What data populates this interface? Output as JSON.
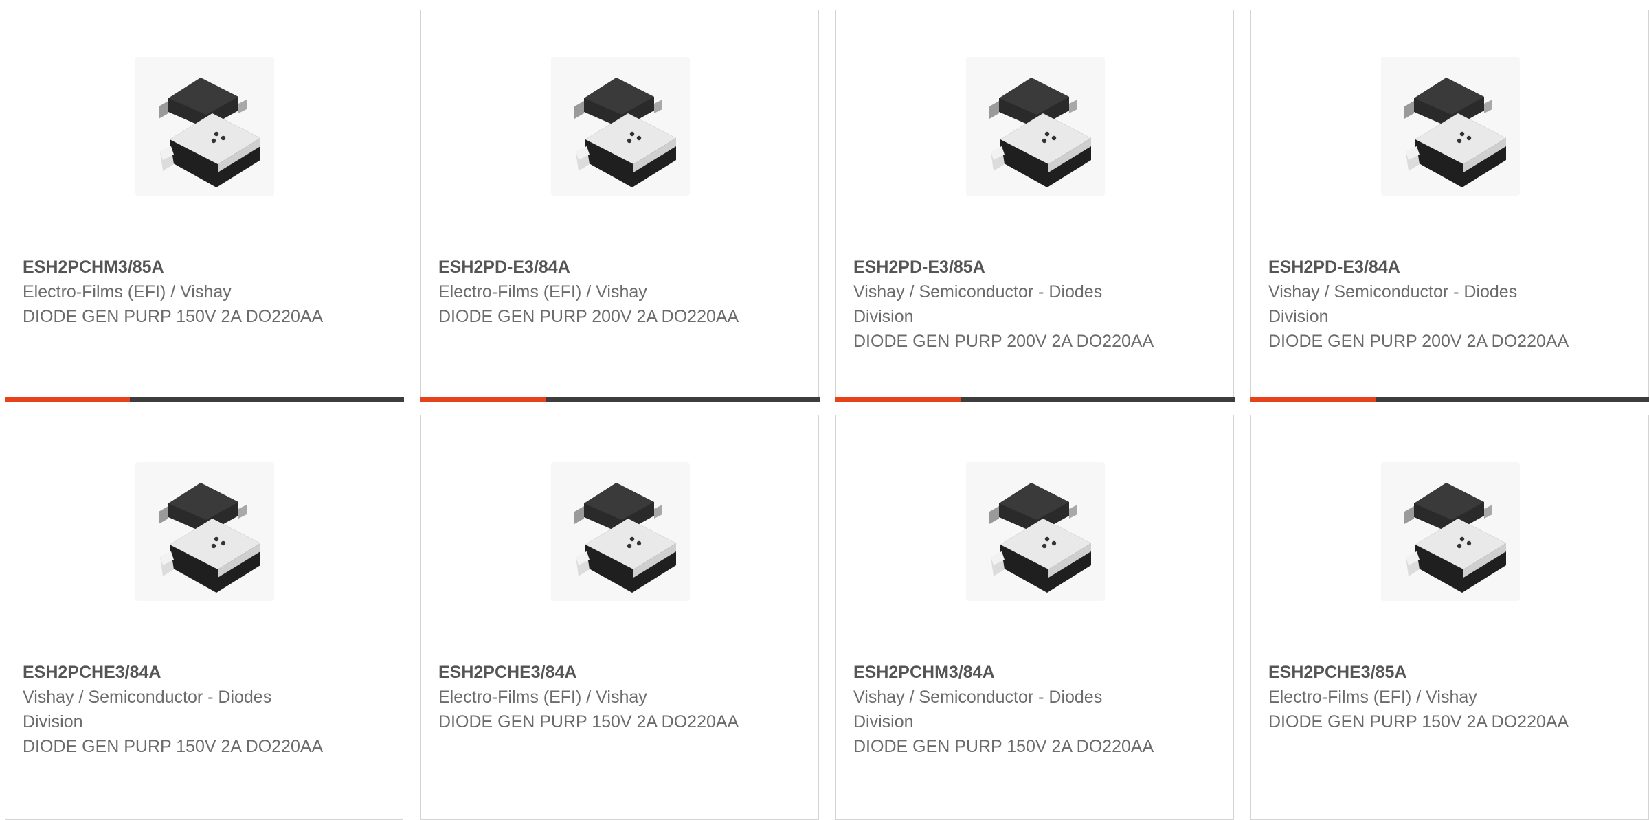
{
  "colors": {
    "accent": "#e8421a",
    "bar_dark": "#3d3d3d",
    "card_border": "#d4d4d4",
    "text": "#6b6b6b",
    "part_number": "#555555"
  },
  "products": [
    {
      "part_number": "ESH2PCHM3/85A",
      "manufacturer": "Electro-Films (EFI) / Vishay",
      "description": "DIODE GEN PURP 150V 2A DO220AA",
      "image_icon": "diode-package-icon"
    },
    {
      "part_number": "ESH2PD-E3/84A",
      "manufacturer": "Electro-Films (EFI) / Vishay",
      "description": "DIODE GEN PURP 200V 2A DO220AA",
      "image_icon": "diode-package-icon"
    },
    {
      "part_number": "ESH2PD-E3/85A",
      "manufacturer": "Vishay / Semiconductor - Diodes Division",
      "description": "DIODE GEN PURP 200V 2A DO220AA",
      "image_icon": "diode-package-icon"
    },
    {
      "part_number": "ESH2PD-E3/84A",
      "manufacturer": "Vishay / Semiconductor - Diodes Division",
      "description": "DIODE GEN PURP 200V 2A DO220AA",
      "image_icon": "diode-package-icon"
    },
    {
      "part_number": "ESH2PCHE3/84A",
      "manufacturer": "Vishay / Semiconductor - Diodes Division",
      "description": "DIODE GEN PURP 150V 2A DO220AA",
      "image_icon": "diode-package-icon"
    },
    {
      "part_number": "ESH2PCHE3/84A",
      "manufacturer": "Electro-Films (EFI) / Vishay",
      "description": "DIODE GEN PURP 150V 2A DO220AA",
      "image_icon": "diode-package-icon"
    },
    {
      "part_number": "ESH2PCHM3/84A",
      "manufacturer": "Vishay / Semiconductor - Diodes Division",
      "description": "DIODE GEN PURP 150V 2A DO220AA",
      "image_icon": "diode-package-icon"
    },
    {
      "part_number": "ESH2PCHE3/85A",
      "manufacturer": "Electro-Films (EFI) / Vishay",
      "description": "DIODE GEN PURP 150V 2A DO220AA",
      "image_icon": "diode-package-icon"
    }
  ]
}
